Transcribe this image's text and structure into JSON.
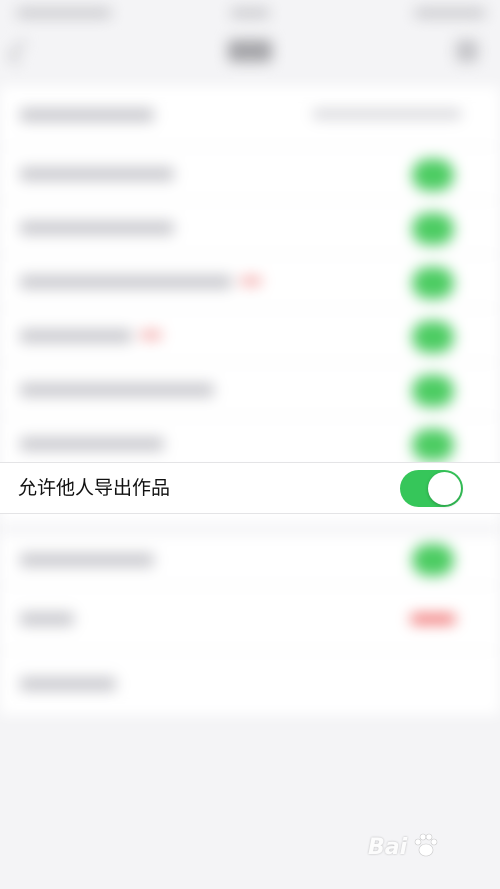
{
  "focused_setting": {
    "label": "允许他人导出作品",
    "toggle_state": "on",
    "toggle_color": "#36c65a"
  },
  "background_rows": [
    {
      "kind": "value"
    },
    {
      "kind": "toggle"
    },
    {
      "kind": "toggle"
    },
    {
      "kind": "toggle",
      "has_red_badge": true
    },
    {
      "kind": "toggle",
      "has_red_badge": true
    },
    {
      "kind": "toggle"
    },
    {
      "kind": "toggle"
    },
    {
      "kind": "toggle"
    },
    {
      "kind": "red-pill"
    },
    {
      "kind": "plain"
    }
  ],
  "watermark": {
    "brand": "Bai",
    "icon": "paw-icon"
  }
}
